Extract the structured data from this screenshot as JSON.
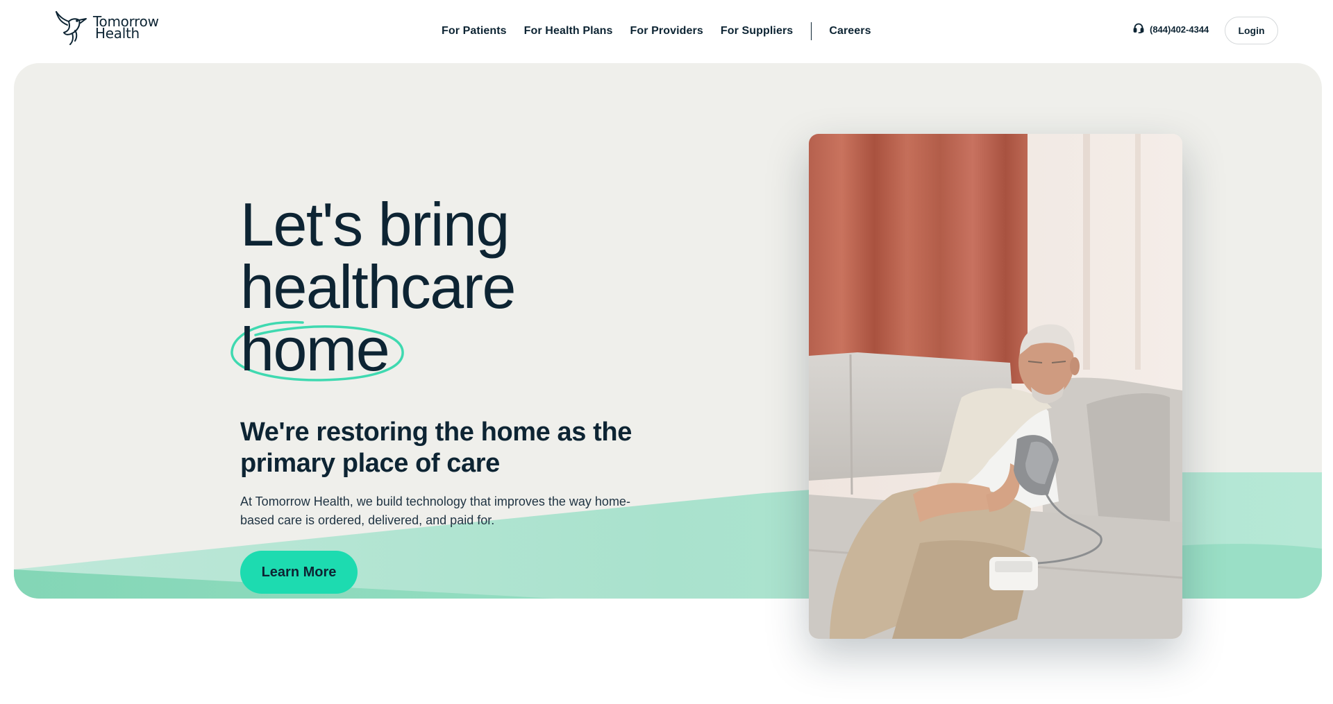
{
  "brand": {
    "name_line1": "Tomorrow",
    "name_line2": "Health",
    "logo_icon": "hummingbird-icon",
    "text_color": "#0d2433"
  },
  "nav": {
    "items": [
      {
        "label": "For Patients"
      },
      {
        "label": "For Health Plans"
      },
      {
        "label": "For Providers"
      },
      {
        "label": "For Suppliers"
      }
    ],
    "careers": "Careers"
  },
  "header_right": {
    "phone_icon": "headset-icon",
    "phone": "(844)402-4344",
    "login_label": "Login"
  },
  "hero": {
    "headline_line1": "Let's bring",
    "headline_line2": "healthcare",
    "headline_line3": "home",
    "subhead": "We're restoring the home as the primary place of care",
    "body": "At Tomorrow Health, we build technology that improves the way home-based care is ordered, delivered, and paid for.",
    "cta_label": "Learn More",
    "background_color": "#efefeb",
    "accent_color": "#1ddbb0",
    "highlight_color": "#3fd9b0"
  },
  "photo": {
    "subject": "senior-man-blood-pressure-photo"
  }
}
